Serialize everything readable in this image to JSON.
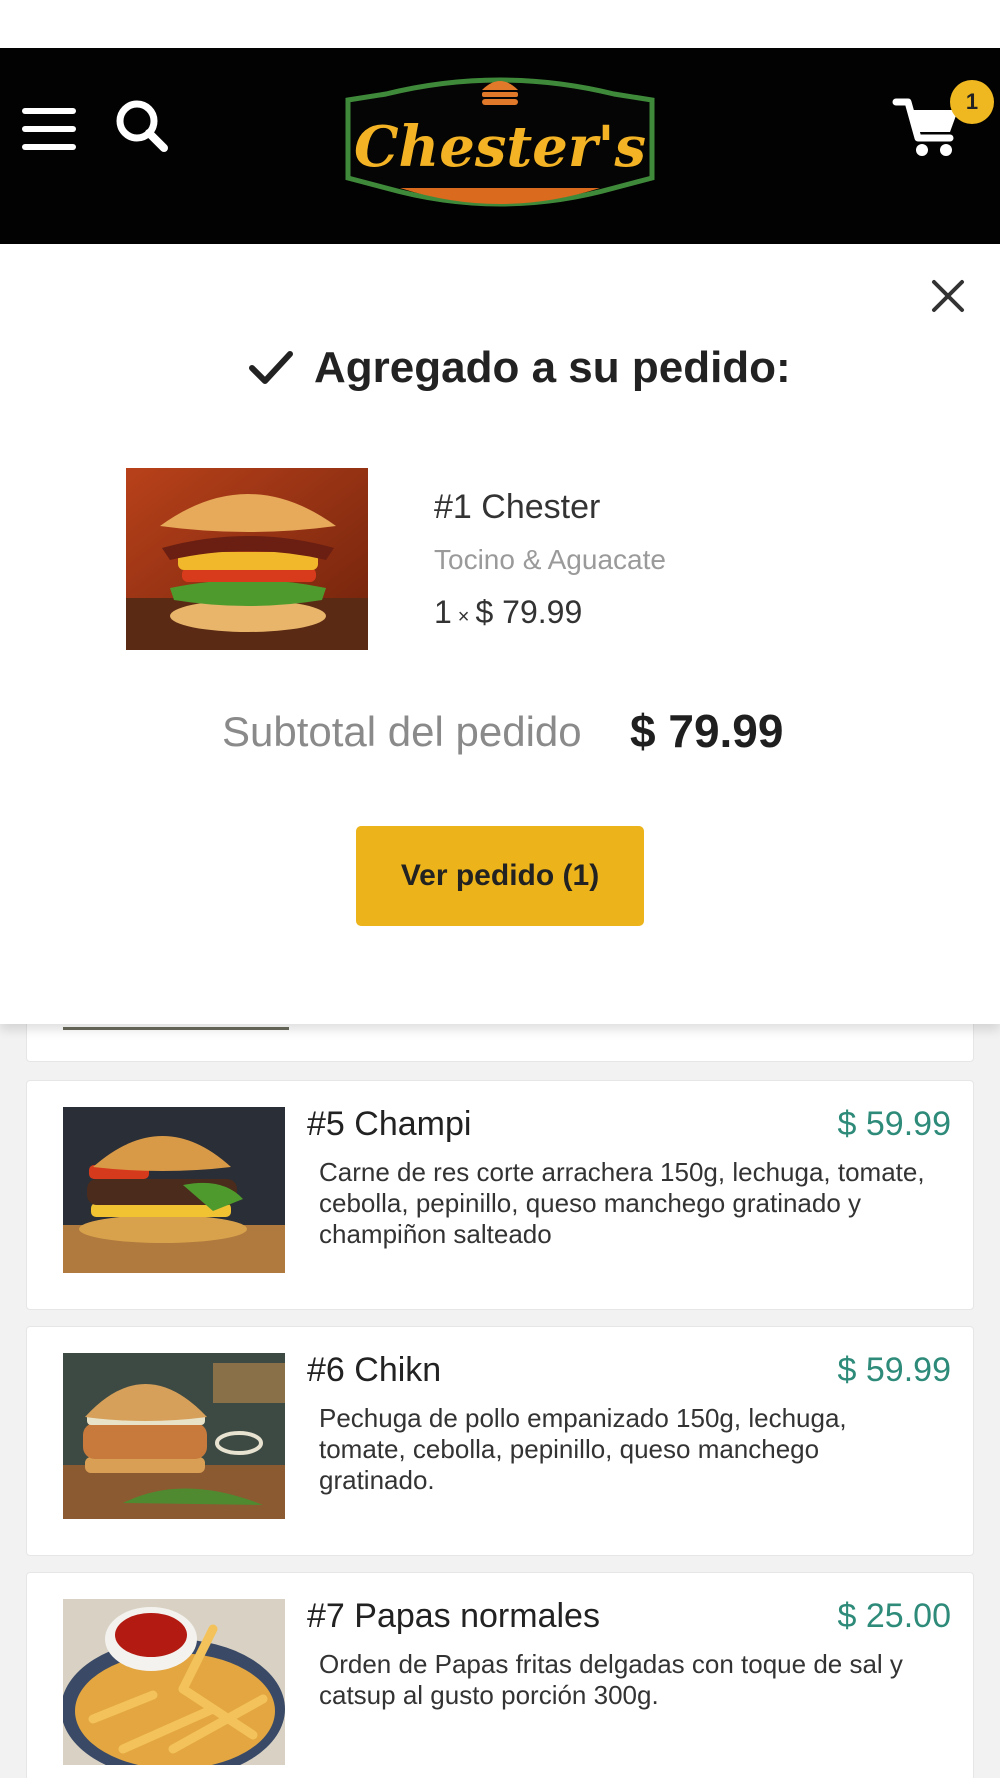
{
  "header": {
    "brand": "Chester's",
    "cart_count": "1"
  },
  "popup": {
    "title": "Agregado a su pedido:",
    "item": {
      "name": "#1 Chester",
      "variant": "Tocino & Aguacate",
      "qty": "1",
      "times": "×",
      "price": "$ 79.99"
    },
    "subtotal_label": "Subtotal del pedido",
    "subtotal_value": "$ 79.99",
    "view_button": "Ver pedido (1)"
  },
  "menu": {
    "items": [
      {
        "name": "#5 Champi",
        "price": "$ 59.99",
        "description": "Carne de res corte arrachera 150g, lechuga, tomate, cebolla, pepinillo, queso manchego gratinado y champiñon salteado"
      },
      {
        "name": "#6 Chikn",
        "price": "$ 59.99",
        "description": "Pechuga de pollo empanizado 150g, lechuga, tomate, cebolla, pepinillo, queso manchego gratinado."
      },
      {
        "name": "#7 Papas normales",
        "price": "$ 25.00",
        "description": "Orden de Papas fritas delgadas con toque de sal y catsup al gusto porción 300g."
      }
    ]
  },
  "colors": {
    "header_bg": "#020202",
    "accent": "#ecb41a",
    "price": "#2e8b7a",
    "logo_text": "#f3b324",
    "logo_border": "#3f8a3a"
  },
  "icons": [
    "menu-icon",
    "search-icon",
    "cart-icon",
    "close-icon",
    "check-icon"
  ]
}
